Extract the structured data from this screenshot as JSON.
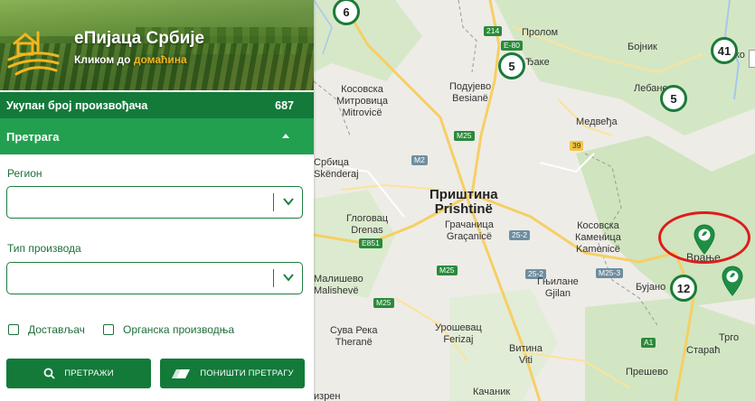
{
  "brand": {
    "title": "еПијаца Србије",
    "subtitle_prefix": "Кликом до ",
    "subtitle_accent": "домаћина"
  },
  "stats": {
    "label": "Укупан број произвођача",
    "value": "687"
  },
  "search": {
    "header": "Претрага",
    "region_label": "Регион",
    "region_value": "",
    "product_type_label": "Тип производа",
    "product_type_value": "",
    "checkbox_delivery": "Достављач",
    "checkbox_organic": "Органска производња",
    "search_button": "ПРЕТРАЖИ",
    "reset_button": "ПОНИШТИ ПРЕТРАГУ"
  },
  "colors": {
    "dark_green": "#137a3a",
    "green": "#22a050",
    "accent": "#f2b61f",
    "highlight": "#e01b1b"
  },
  "map": {
    "labels": {
      "kosovska_mitrovica": "Косовска\nМитровица\nMitrovicë",
      "podujevo": "Подујево\nBesianë",
      "prolom": "Пролом",
      "bojnik": "Бојник",
      "lebane": "Лебане",
      "leskovac": "Леско",
      "medvedja": "Медвеђа",
      "bake": "Ђаке",
      "srbica": "Србица\nSkënderaj",
      "pristina": "Приштина\nPrishtinë",
      "gracanica": "Грачаница\nGraçanicë",
      "glogovac": "Глоговац\nDrenas",
      "kosovska_kamenica": "Косовска\nКаменица\nKamenicë",
      "vranje": "Врање",
      "bujanovac": "Бујано",
      "gnjilane": "Гњилане\nGjilan",
      "malisevo": "Малишево\nMalishevë",
      "urosevac": "Урошевац\nFerizaj",
      "suva_reka": "Сува Река\nTheranë",
      "vitina": "Витина\nViti",
      "presevo": "Прешево",
      "kacanik": "Качаник",
      "trgoviste": "Трго",
      "staraca": "Стараћ",
      "prizren": "изрен"
    },
    "roads": [
      "214",
      "E-80",
      "M25",
      "M2",
      "39",
      "25-2",
      "25-2",
      "M25-3",
      "M25",
      "E851",
      "M25",
      "A1"
    ],
    "clusters": [
      "6",
      "5",
      "41",
      "5",
      "12"
    ],
    "pins": [
      "producer-pin",
      "producer-pin"
    ]
  }
}
